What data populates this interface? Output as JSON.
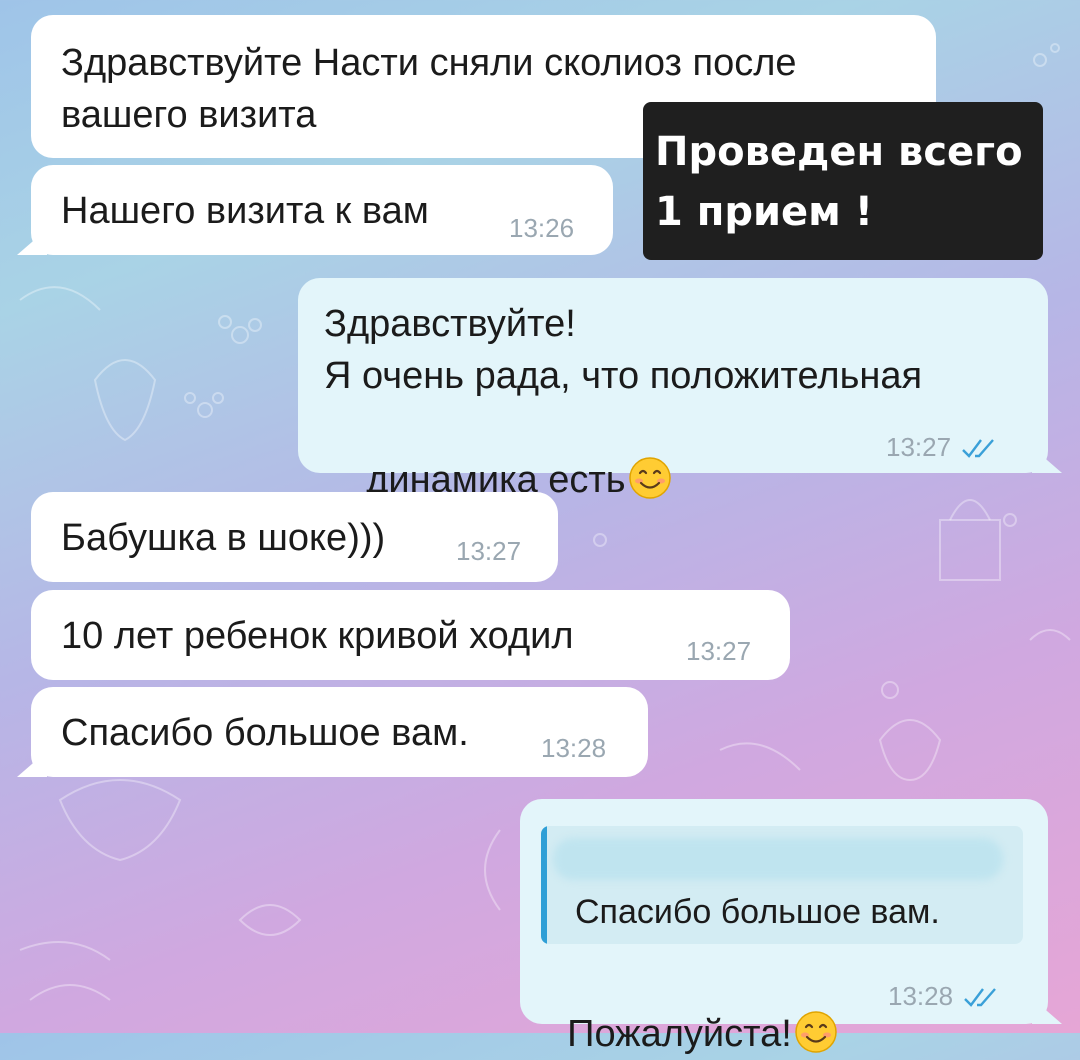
{
  "overlay": {
    "line1": "Проведен всего",
    "line2": "1 прием !"
  },
  "messages": [
    {
      "direction": "incoming",
      "line1": "Здравствуйте Насти сняли сколиоз после",
      "line2": "вашего визита",
      "time": ""
    },
    {
      "direction": "incoming",
      "text": "Нашего визита к вам",
      "time": "13:26"
    },
    {
      "direction": "outgoing",
      "line1": "Здравствуйте!",
      "line2": "Я очень рада, что положительная",
      "line3": "динамика есть",
      "emoji": "smiling-face-emoji",
      "time": "13:27",
      "read": true
    },
    {
      "direction": "incoming",
      "text": "Бабушка в шоке)))",
      "time": "13:27"
    },
    {
      "direction": "incoming",
      "text": "10 лет ребенок кривой ходил",
      "time": "13:27"
    },
    {
      "direction": "incoming",
      "text": "Спасибо большое вам.",
      "time": "13:28"
    },
    {
      "direction": "outgoing",
      "quote": {
        "text": "Спасибо большое вам.",
        "author_blurred": true
      },
      "text": "Пожалуйста!",
      "emoji": "smiling-face-emoji",
      "time": "13:28",
      "read": true
    }
  ],
  "colors": {
    "incoming_bubble": "#ffffff",
    "outgoing_bubble": "#e3f5fa",
    "read_checks": "#3aa0d8",
    "timestamp": "#9aa7b1",
    "quote_bar": "#2f9fd6",
    "overlay_bg": "#1f1f1f"
  }
}
